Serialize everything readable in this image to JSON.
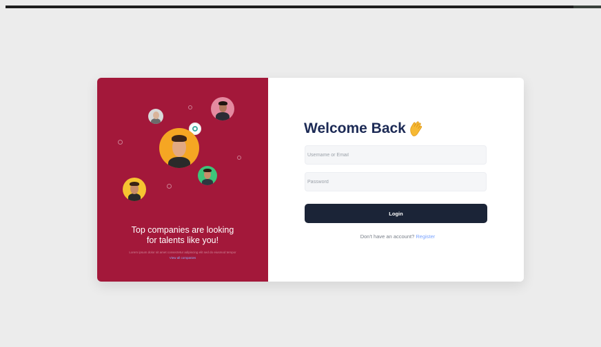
{
  "left_panel": {
    "tagline_line1": "Top companies are looking",
    "tagline_line2": "for talents like you!",
    "sub_text": "Lorem ipsum dolor sit amet consectetur adipiscing elit sed do eiusmod tempor",
    "sub_link": "View all companies",
    "background_color": "#a3183a"
  },
  "login": {
    "title": "Welcome Back",
    "title_emoji": "wave-hand-icon",
    "username_placeholder": "Username or Email",
    "password_placeholder": "Password",
    "login_label": "Login",
    "no_account_text": "Don't have an account?",
    "register_label": "Register",
    "button_color": "#1b2437",
    "title_color": "#1c2a55",
    "link_color": "#7aa3ff"
  }
}
